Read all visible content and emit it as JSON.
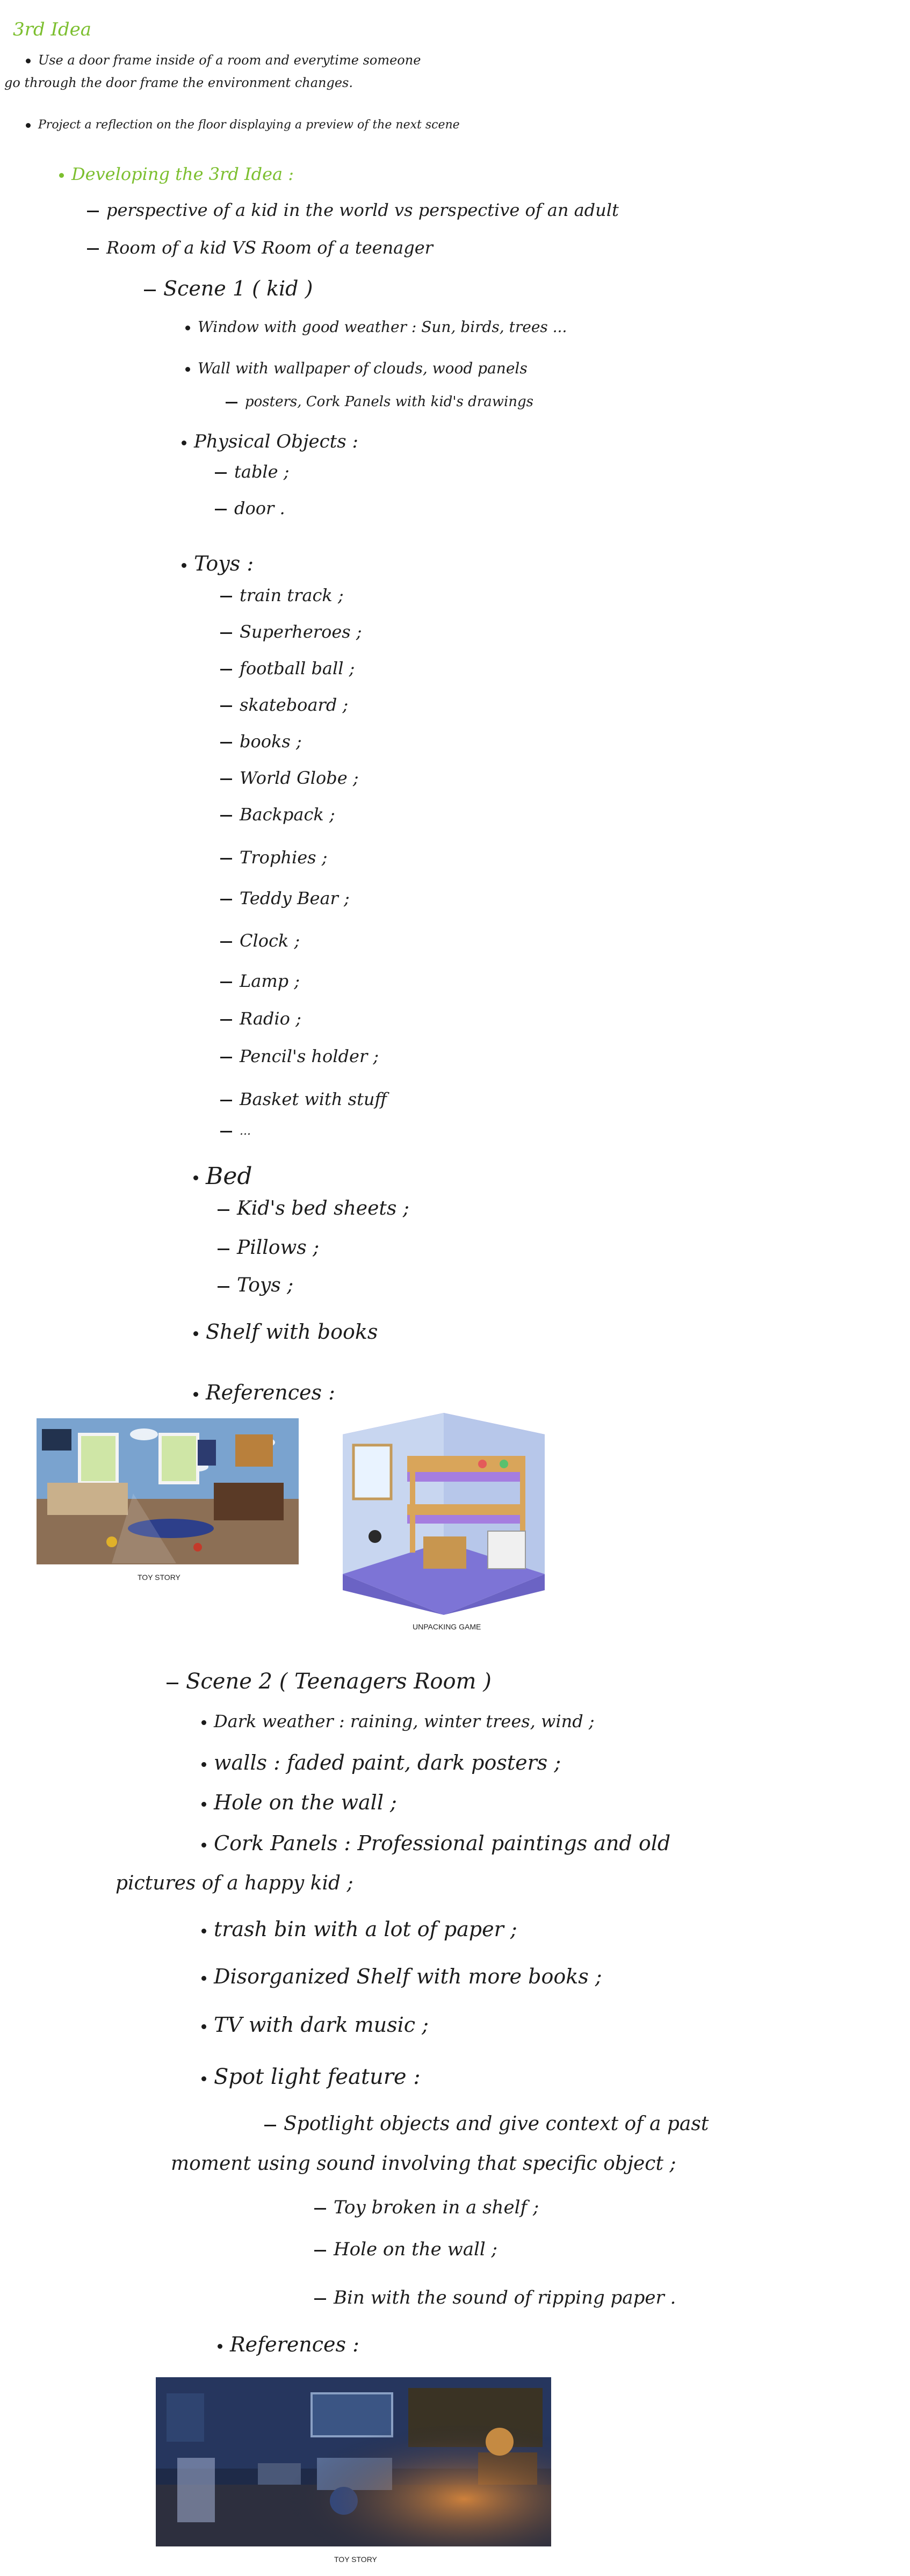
{
  "title": "3rd Idea",
  "intro": [
    "Use a door frame inside of a room and everytime someone",
    "go through the door frame the environment changes.",
    "Project a reflection on the floor displaying a preview of the next scene"
  ],
  "developing": "Developing the 3rd Idea :",
  "dev_points": [
    "perspective of a kid in the world vs perspective of an adult",
    "Room of a kid VS Room of a teenager"
  ],
  "scene1": {
    "heading": "Scene 1 ( kid )",
    "window": "Window with good weather : Sun, birds, trees ...",
    "wall": "Wall with wallpaper of clouds, wood panels",
    "wall_sub": "posters, Cork Panels with kid's drawings",
    "physical": "Physical Objects :",
    "physical_items": [
      "table ;",
      "door ."
    ],
    "toys": "Toys :",
    "toys_items": [
      "train track ;",
      "Superheroes ;",
      "football ball ;",
      "skateboard ;",
      "books ;",
      "World Globe ;",
      "Backpack ;",
      "Trophies ;",
      "Teddy Bear ;",
      "Clock ;",
      "Lamp ;",
      "Radio ;",
      "Pencil's holder ;",
      "Basket with stuff",
      "..."
    ],
    "bed": "Bed",
    "bed_items": [
      "Kid's bed sheets ;",
      "Pillows ;",
      "Toys ;"
    ],
    "shelf": "Shelf with books",
    "references": "References :",
    "ref_caption_1": "TOY STORY",
    "ref_caption_2": "UNPACKING GAME"
  },
  "scene2": {
    "heading": "Scene 2 ( Teenagers Room )",
    "items": [
      "Dark weather : raining, winter trees, wind ;",
      "walls : faded paint, dark posters ;",
      "Hole on the wall ;",
      "Cork Panels : Professional paintings and old"
    ],
    "items_cont": "pictures of a happy kid ;",
    "items2": [
      "trash bin with a lot of paper ;",
      "Disorganized Shelf with more books ;",
      "TV with dark music ;"
    ],
    "spotlight": "Spot light feature :",
    "spotlight_text_1": "Spotlight objects and give context of a past",
    "spotlight_text_2": "moment using sound involving that specific object ;",
    "spotlight_items": [
      "Toy broken in a shelf ;",
      "Hole on the wall ;",
      "Bin with the sound of ripping paper ."
    ],
    "references": "References :",
    "ref_caption": "TOY STORY"
  },
  "colors": {
    "accent_green": "#7cbf2f",
    "ink": "#1c1c1c"
  }
}
